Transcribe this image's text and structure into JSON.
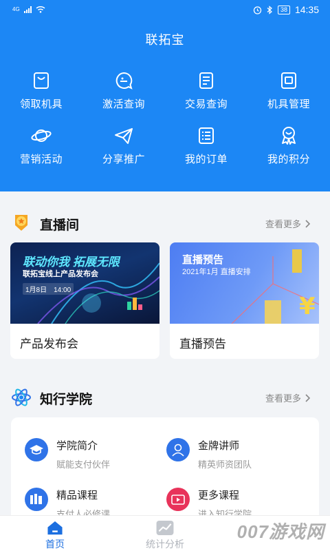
{
  "status_bar": {
    "network": "4G",
    "battery": "38",
    "time": "14:35"
  },
  "app_title": "联拓宝",
  "header_grid": [
    {
      "label": "领取机具",
      "icon": "bag-icon"
    },
    {
      "label": "激活查询",
      "icon": "chat-search-icon"
    },
    {
      "label": "交易查询",
      "icon": "document-icon"
    },
    {
      "label": "机具管理",
      "icon": "device-icon"
    },
    {
      "label": "营销活动",
      "icon": "planet-icon"
    },
    {
      "label": "分享推广",
      "icon": "paper-plane-icon"
    },
    {
      "label": "我的订单",
      "icon": "list-icon"
    },
    {
      "label": "我的积分",
      "icon": "medal-icon"
    }
  ],
  "live_section": {
    "title": "直播间",
    "more": "查看更多",
    "cards": [
      {
        "title": "产品发布会",
        "banner_head": "联动你我 拓展无限",
        "banner_sub": "联拓宝线上产品发布会",
        "banner_date": "1月8日　14:00"
      },
      {
        "title": "直播预告",
        "banner_head": "直播预告",
        "banner_sub": "2021年1月 直播安排"
      }
    ]
  },
  "academy_section": {
    "title": "知行学院",
    "more": "查看更多",
    "items": [
      {
        "title": "学院简介",
        "subtitle": "赋能支付伙伴",
        "icon": "graduation-cap-icon",
        "color": "#2f73e8"
      },
      {
        "title": "金牌讲师",
        "subtitle": "精英师资团队",
        "icon": "teacher-icon",
        "color": "#2f73e8"
      },
      {
        "title": "精品课程",
        "subtitle": "支付人必修课",
        "icon": "books-icon",
        "color": "#2f73e8"
      },
      {
        "title": "更多课程",
        "subtitle": "进入知行学院",
        "icon": "video-play-icon",
        "color": "#e8335a"
      }
    ]
  },
  "tabbar": [
    {
      "label": "首页",
      "icon": "home-icon",
      "active": true
    },
    {
      "label": "统计分析",
      "icon": "chart-line-icon",
      "active": false
    }
  ],
  "watermark": "007游戏网",
  "colors": {
    "primary": "#1c87f5",
    "active_tab": "#1c6fe0",
    "inactive_tab": "#b0b4bb"
  }
}
